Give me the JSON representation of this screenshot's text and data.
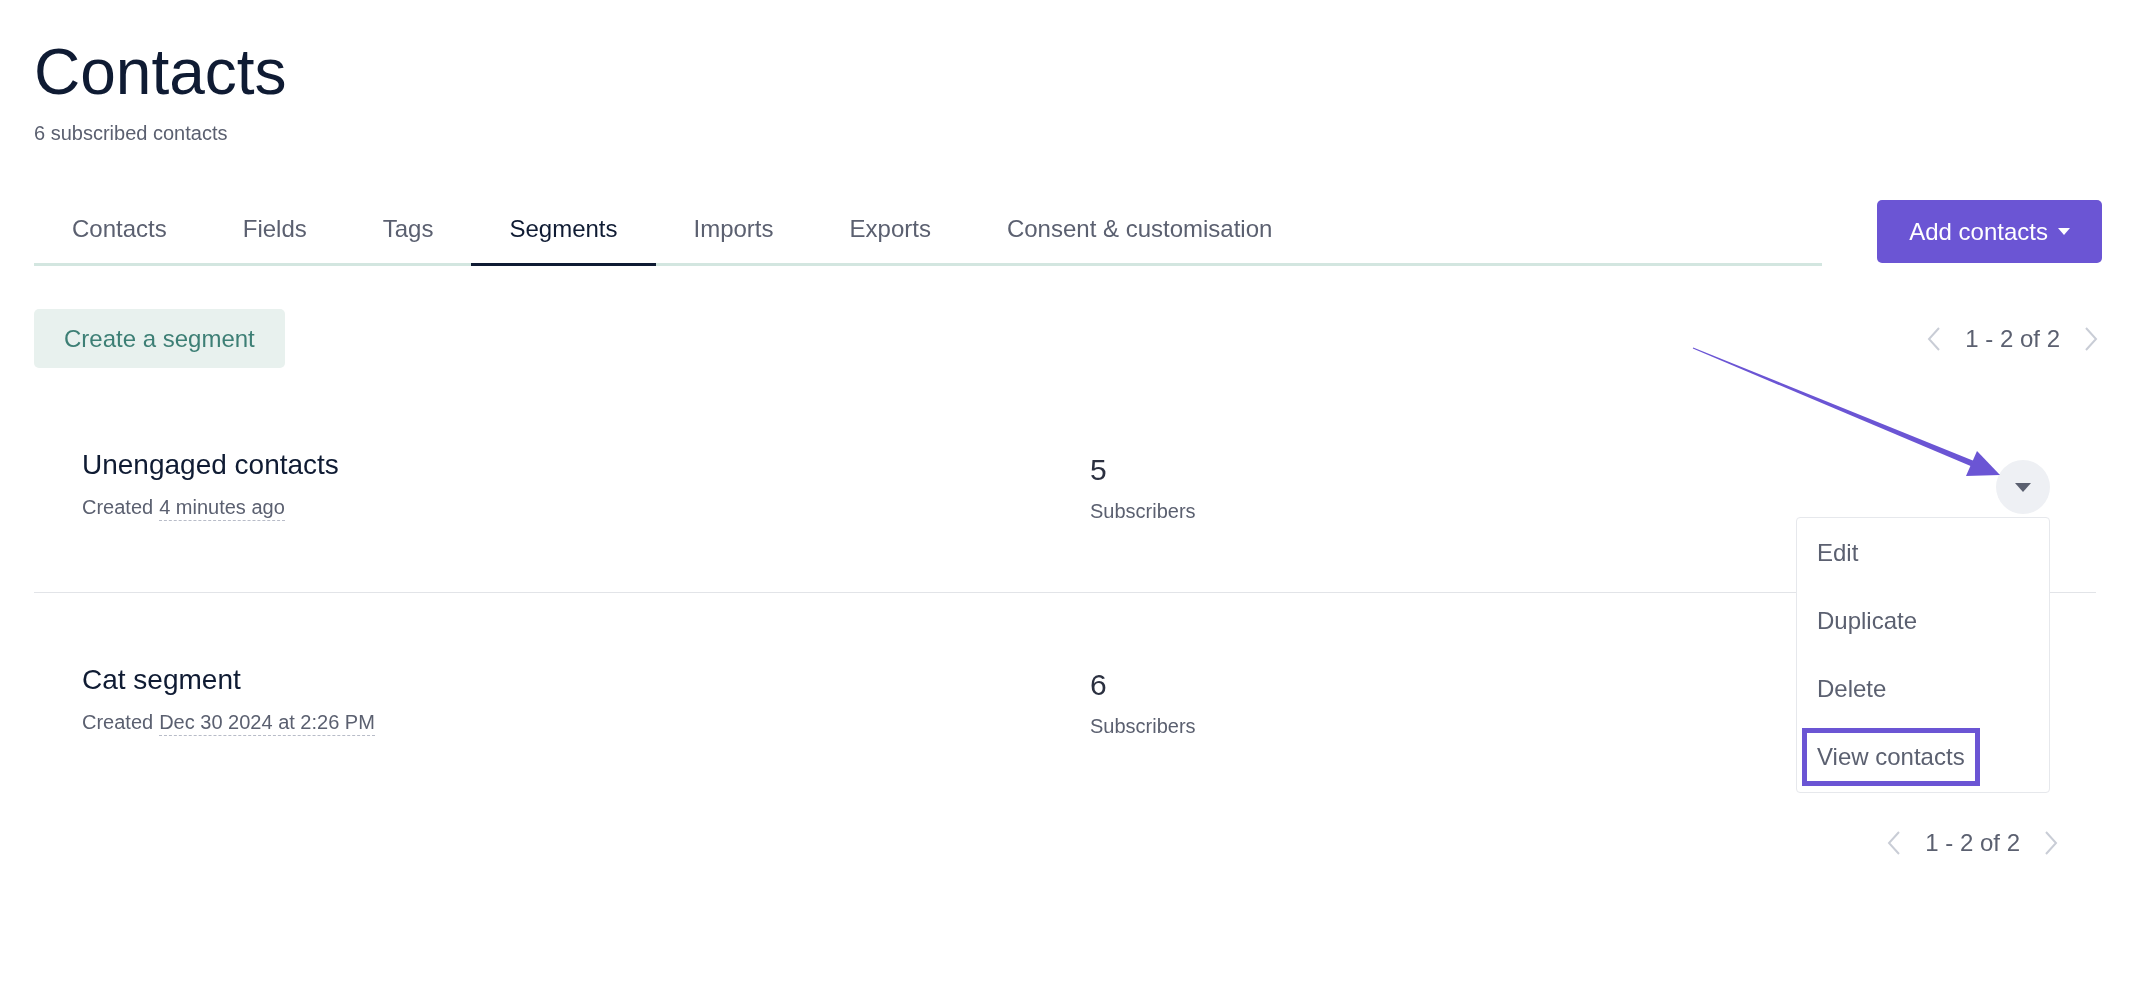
{
  "page": {
    "title": "Contacts",
    "subtitle": "6 subscribed contacts"
  },
  "tabs": [
    {
      "label": "Contacts",
      "selected": false
    },
    {
      "label": "Fields",
      "selected": false
    },
    {
      "label": "Tags",
      "selected": false
    },
    {
      "label": "Segments",
      "selected": true
    },
    {
      "label": "Imports",
      "selected": false
    },
    {
      "label": "Exports",
      "selected": false
    },
    {
      "label": "Consent & customisation",
      "selected": false
    }
  ],
  "add_button": {
    "label": "Add contacts"
  },
  "create_button": {
    "label": "Create a segment"
  },
  "pagination_top": {
    "label": "1 - 2 of 2"
  },
  "segments": [
    {
      "name": "Unengaged contacts",
      "created_label": "Created",
      "created_time": "4 minutes ago",
      "count": "5",
      "count_label": "Subscribers"
    },
    {
      "name": "Cat segment",
      "created_label": "Created",
      "created_time": "Dec 30 2024 at 2:26 PM",
      "count": "6",
      "count_label": "Subscribers"
    }
  ],
  "actions_menu": {
    "items": [
      {
        "label": "Edit",
        "highlighted": false
      },
      {
        "label": "Duplicate",
        "highlighted": false
      },
      {
        "label": "Delete",
        "highlighted": false
      },
      {
        "label": "View contacts",
        "highlighted": true
      }
    ]
  },
  "pagination_bottom": {
    "label": "1 - 2 of 2"
  }
}
